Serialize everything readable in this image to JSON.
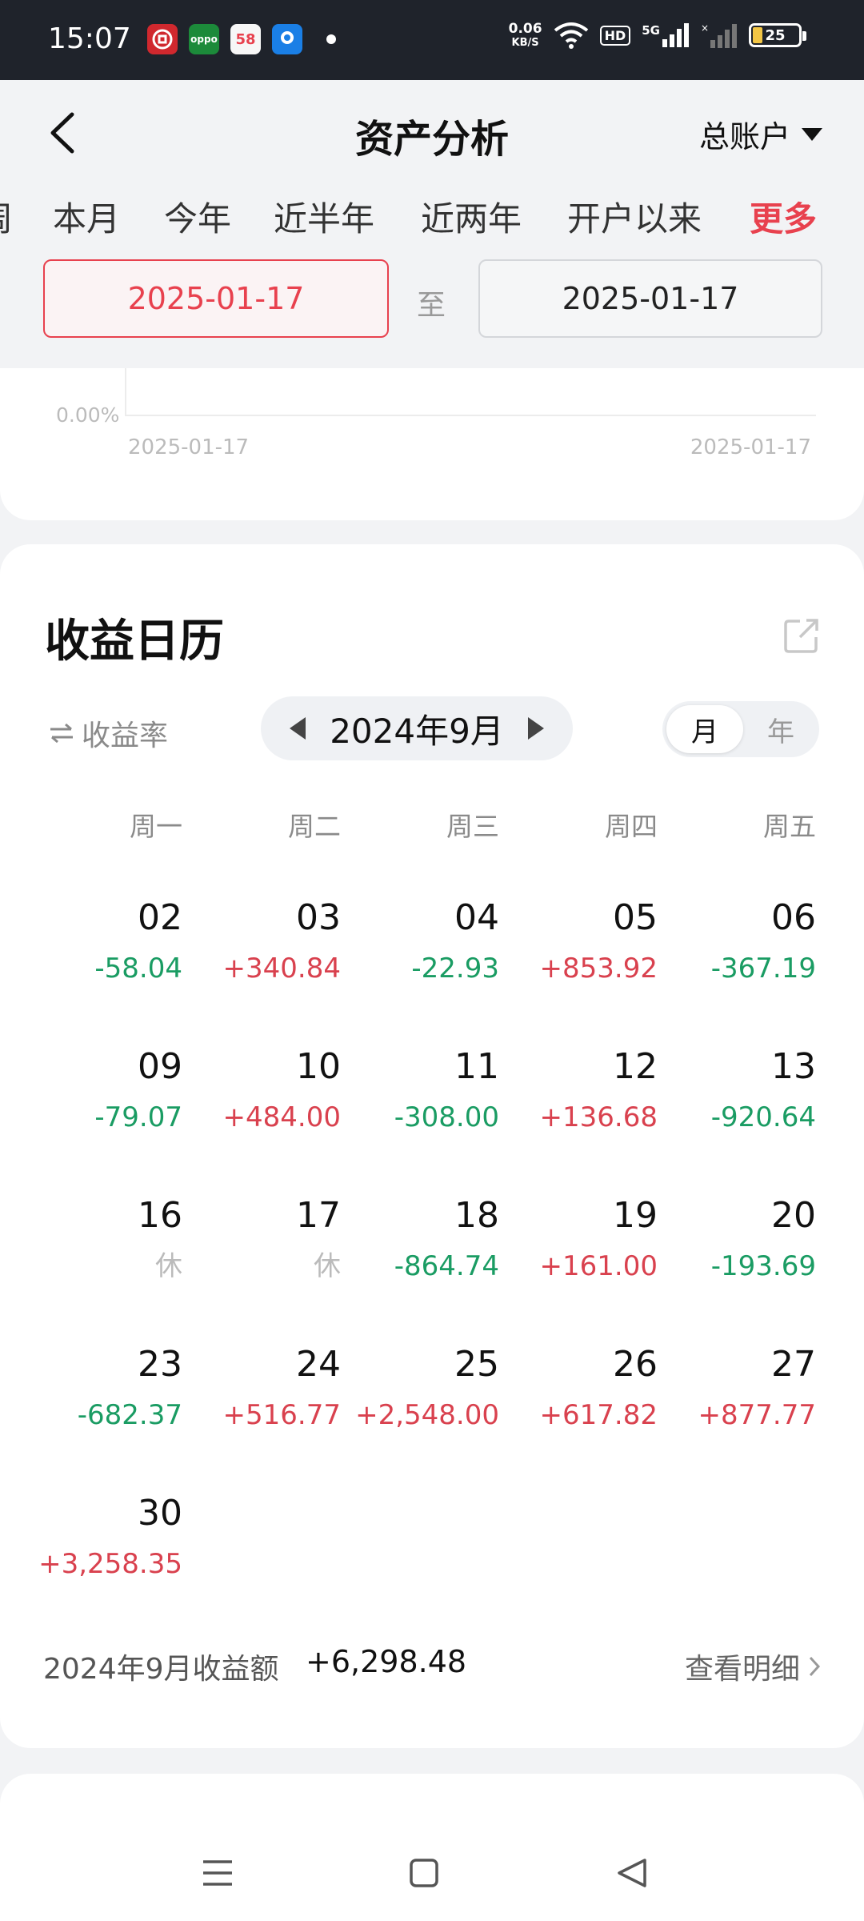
{
  "status_bar": {
    "time": "15:07",
    "app_icons": [
      {
        "name": "bank-app-icon",
        "color": "#d0282e",
        "label": ""
      },
      {
        "name": "oppo-app-icon",
        "color": "#1c8a3a",
        "label": "oppo"
      },
      {
        "name": "58-app-icon",
        "color": "#f7f7f7",
        "label": "58"
      },
      {
        "name": "map-app-icon",
        "color": "#1a7fe6",
        "label": ""
      }
    ],
    "net_speed_value": "0.06",
    "net_speed_unit": "KB/S",
    "hd_label": "HD",
    "signal_label": "5G",
    "battery": "25"
  },
  "header": {
    "title": "资产分析",
    "account": "总账户"
  },
  "period_tabs": [
    {
      "label": "周"
    },
    {
      "label": "本月"
    },
    {
      "label": "今年"
    },
    {
      "label": "近半年"
    },
    {
      "label": "近两年"
    },
    {
      "label": "开户以来"
    },
    {
      "label": "更多"
    }
  ],
  "date_range": {
    "start": "2025-01-17",
    "separator": "至",
    "end": "2025-01-17"
  },
  "chart": {
    "y_label": "0.00%",
    "x_start": "2025-01-17",
    "x_end": "2025-01-17"
  },
  "calendar": {
    "title": "收益日历",
    "metric_toggle": "收益率",
    "month": "2024年9月",
    "view_month": "月",
    "view_year": "年",
    "weekdays": [
      "周一",
      "周二",
      "周三",
      "周四",
      "周五"
    ],
    "weeks": [
      [
        {
          "day": "02",
          "value": "-58.04",
          "kind": "neg"
        },
        {
          "day": "03",
          "value": "+340.84",
          "kind": "pos"
        },
        {
          "day": "04",
          "value": "-22.93",
          "kind": "neg"
        },
        {
          "day": "05",
          "value": "+853.92",
          "kind": "pos"
        },
        {
          "day": "06",
          "value": "-367.19",
          "kind": "neg"
        }
      ],
      [
        {
          "day": "09",
          "value": "-79.07",
          "kind": "neg"
        },
        {
          "day": "10",
          "value": "+484.00",
          "kind": "pos"
        },
        {
          "day": "11",
          "value": "-308.00",
          "kind": "neg"
        },
        {
          "day": "12",
          "value": "+136.68",
          "kind": "pos"
        },
        {
          "day": "13",
          "value": "-920.64",
          "kind": "neg"
        }
      ],
      [
        {
          "day": "16",
          "value": "休",
          "kind": "rest"
        },
        {
          "day": "17",
          "value": "休",
          "kind": "rest"
        },
        {
          "day": "18",
          "value": "-864.74",
          "kind": "neg"
        },
        {
          "day": "19",
          "value": "+161.00",
          "kind": "pos"
        },
        {
          "day": "20",
          "value": "-193.69",
          "kind": "neg"
        }
      ],
      [
        {
          "day": "23",
          "value": "-682.37",
          "kind": "neg"
        },
        {
          "day": "24",
          "value": "+516.77",
          "kind": "pos"
        },
        {
          "day": "25",
          "value": "+2,548.00",
          "kind": "pos"
        },
        {
          "day": "26",
          "value": "+617.82",
          "kind": "pos"
        },
        {
          "day": "27",
          "value": "+877.77",
          "kind": "pos"
        }
      ],
      [
        {
          "day": "30",
          "value": "+3,258.35",
          "kind": "pos"
        }
      ]
    ],
    "summary_label": "2024年9月收益额",
    "summary_value": "+6,298.48",
    "detail_link": "查看明细"
  },
  "colors": {
    "accent": "#e8414e",
    "gain": "#d9414e",
    "loss": "#1a9c63",
    "rest": "#bbbbbb"
  }
}
